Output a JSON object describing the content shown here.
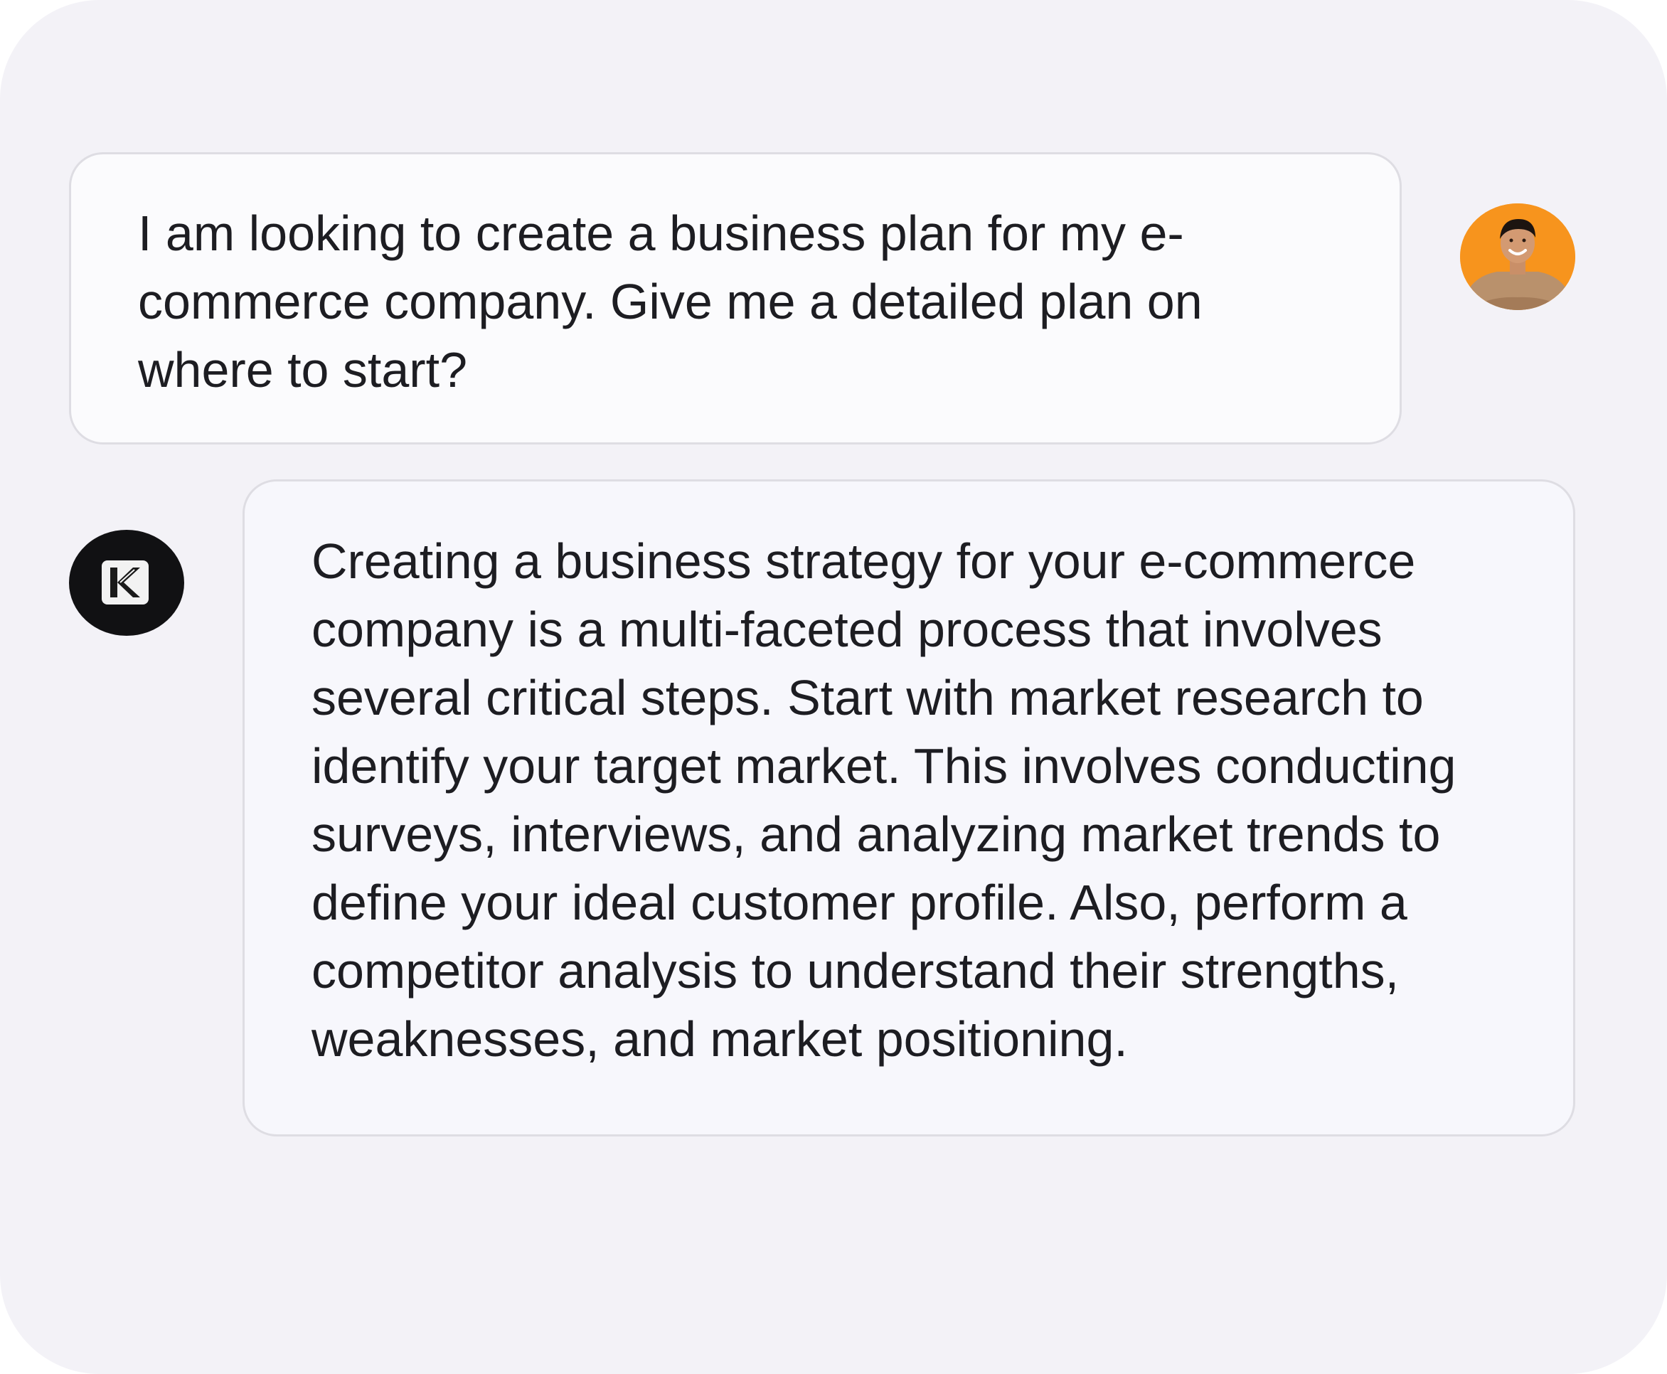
{
  "user_message": {
    "lines": [
      "I am looking to create a business plan for my e-",
      "commerce company. Give me a detailed plan on",
      "where to start?"
    ],
    "avatar_icon": "user-photo-avatar"
  },
  "assistant_message": {
    "lines": [
      "Creating a business strategy for your e-commerce",
      "company is a multi-faceted process that involves",
      "several critical steps. Start with market research to",
      "identify your target market. This involves conducting",
      "surveys, interviews, and analyzing market trends to",
      "define your ideal customer profile. Also, perform a",
      "competitor analysis to understand their strengths,",
      "weaknesses, and market positioning."
    ],
    "avatar_icon": "k-logo-icon"
  },
  "colors": {
    "background": "#f3f2f7",
    "bubble_border": "#dedde3",
    "user_avatar_bg": "#f7941d",
    "ai_avatar_bg": "#111113",
    "text": "#1d1d22"
  }
}
